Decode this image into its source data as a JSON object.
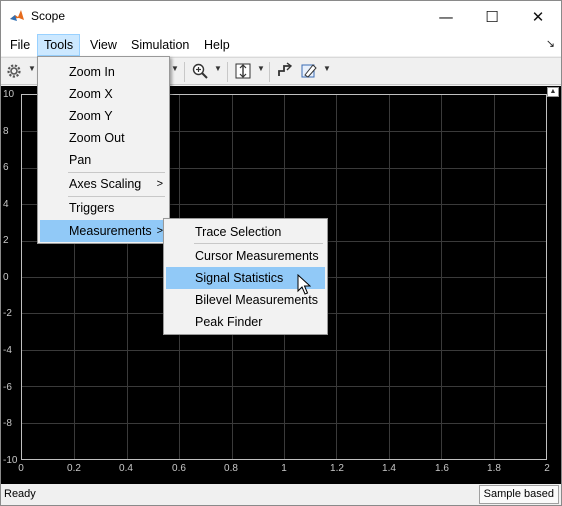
{
  "window": {
    "title": "Scope"
  },
  "title_controls": {
    "minimize": "—",
    "maximize": "☐",
    "close": "✕"
  },
  "menubar": {
    "items": [
      {
        "label": "File"
      },
      {
        "label": "Tools"
      },
      {
        "label": "View"
      },
      {
        "label": "Simulation"
      },
      {
        "label": "Help"
      }
    ]
  },
  "toolbar": {
    "icons": [
      "gear-icon",
      "zoom-icon",
      "scale-axes-icon",
      "step-icon",
      "highlight-icon"
    ]
  },
  "tools_menu": {
    "items": [
      {
        "label": "Zoom In"
      },
      {
        "label": "Zoom X"
      },
      {
        "label": "Zoom Y"
      },
      {
        "label": "Zoom Out"
      },
      {
        "label": "Pan"
      },
      {
        "label": "Axes Scaling",
        "submenu": true
      },
      {
        "label": "Triggers"
      },
      {
        "label": "Measurements",
        "submenu": true,
        "highlighted": true
      }
    ]
  },
  "measurements_menu": {
    "items": [
      {
        "label": "Trace Selection"
      },
      {
        "label": "Cursor Measurements"
      },
      {
        "label": "Signal Statistics",
        "highlighted": true
      },
      {
        "label": "Bilevel Measurements"
      },
      {
        "label": "Peak Finder"
      }
    ]
  },
  "plot": {
    "yticks": [
      "10",
      "8",
      "6",
      "4",
      "2",
      "0",
      "-2",
      "-4",
      "-6",
      "-8",
      "-10"
    ],
    "xticks": [
      "0",
      "0.2",
      "0.4",
      "0.6",
      "0.8",
      "1",
      "1.2",
      "1.4",
      "1.6",
      "1.8",
      "2"
    ],
    "background": "#000000",
    "grid_color": "#3a3a3a"
  },
  "status": {
    "left": "Ready",
    "right": "Sample based"
  },
  "colors": {
    "menu_highlight": "#91c9f7",
    "menubar_active": "#cce8ff"
  }
}
